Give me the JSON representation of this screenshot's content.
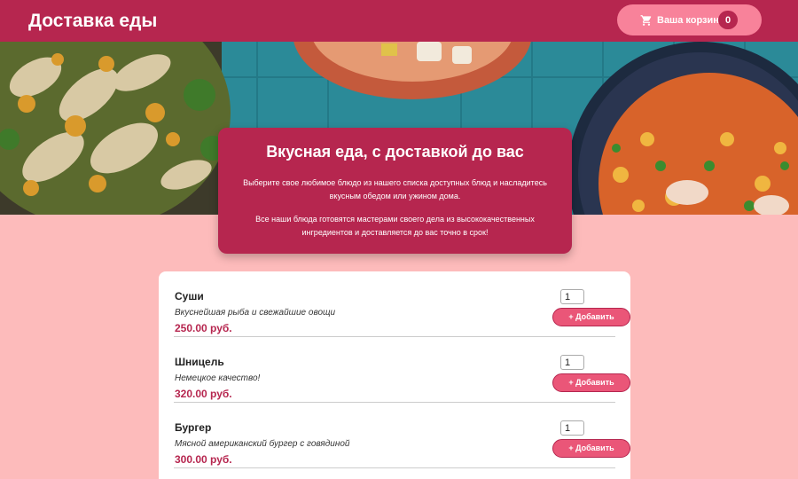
{
  "header": {
    "title": "Доставка еды"
  },
  "cart": {
    "label": "Ваша корзина",
    "count": "0",
    "icon": "cart-icon"
  },
  "hero_card": {
    "title": "Вкусная еда, с доставкой до вас",
    "paragraph1": "Выберите свое любимое блюдо из нашего списка доступных блюд и насладитесь вкусным обедом или ужином дома.",
    "paragraph2": "Все наши блюда готовятся мастерами своего дела из высококачественных ингредиентов и доставляется до вас точно в срок!"
  },
  "meals": [
    {
      "name": "Суши",
      "description": "Вкуснейшая рыба и свежайшие овощи",
      "price": "250.00 руб.",
      "qty": "1",
      "add_label": "+ Добавить"
    },
    {
      "name": "Шницель",
      "description": "Немецкое качество!",
      "price": "320.00 руб.",
      "qty": "1",
      "add_label": "+ Добавить"
    },
    {
      "name": "Бургер",
      "description": "Мясной американский бургер с говядиной",
      "price": "300.00 руб.",
      "qty": "1",
      "add_label": "+ Добавить"
    }
  ],
  "colors": {
    "brand": "#b6264f",
    "accent": "#ea5678",
    "background": "#fdbbbb",
    "cart_button": "#f8829a"
  }
}
